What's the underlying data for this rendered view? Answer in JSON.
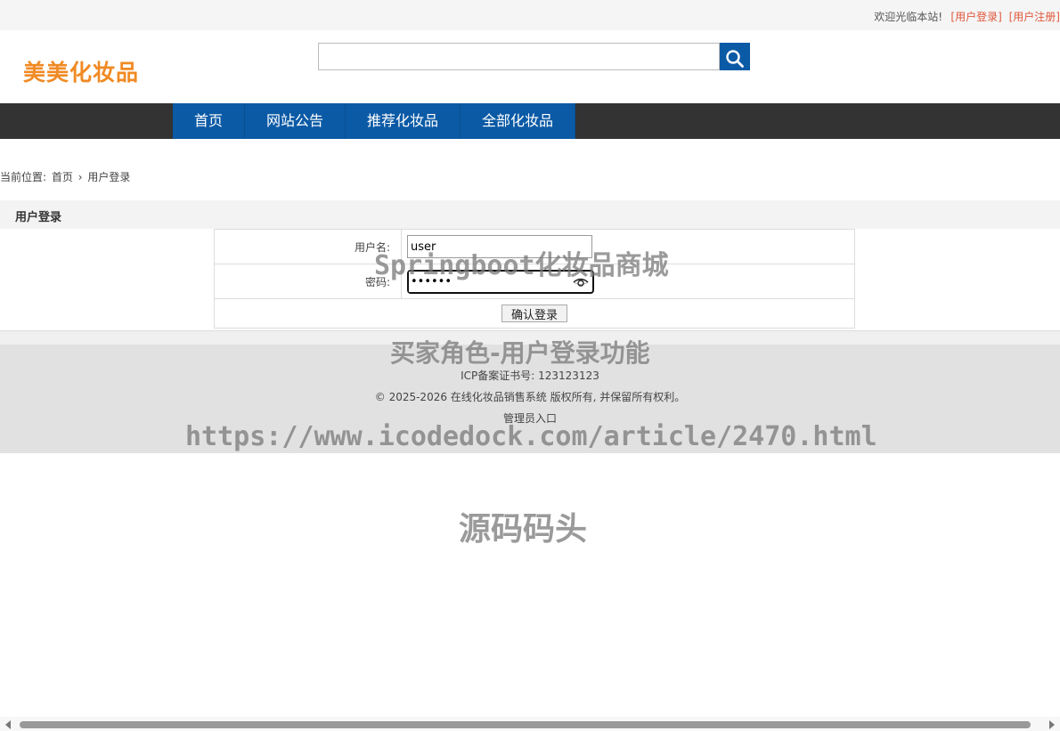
{
  "topbar": {
    "welcome": "欢迎光临本站!",
    "login_link": "[用户登录]",
    "register_link": "[用户注册]"
  },
  "header": {
    "logo": "美美化妆品",
    "search_value": "",
    "search_icon": "search-icon",
    "accent_color": "#0b5aa6",
    "logo_color": "#f08a24"
  },
  "nav": {
    "items": [
      {
        "label": "首页"
      },
      {
        "label": "网站公告"
      },
      {
        "label": "推荐化妆品"
      },
      {
        "label": "全部化妆品"
      }
    ]
  },
  "breadcrumb": {
    "prefix": "当前位置:",
    "home": "首页",
    "separator": "›",
    "current": "用户登录"
  },
  "panel": {
    "title": "用户登录"
  },
  "form": {
    "username_label": "用户名:",
    "username_value": "user",
    "password_label": "密码:",
    "password_value": "••••••",
    "submit_label": "确认登录"
  },
  "footer": {
    "icp": "ICP备案证书号: 123123123",
    "copyright": "© 2025-2026 在线化妆品销售系统 版权所有, 并保留所有权利。",
    "admin_link": "管理员入口"
  },
  "watermarks": {
    "w1": "Springboot化妆品商城",
    "w2": "买家角色-用户登录功能",
    "w3": "https://www.icodedock.com/article/2470.html",
    "w4": "源码码头"
  }
}
